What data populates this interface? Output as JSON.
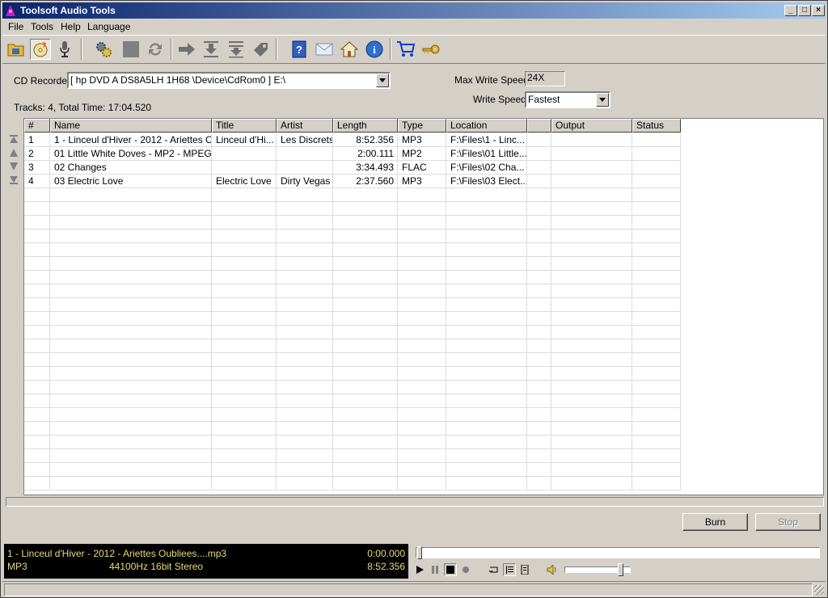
{
  "window": {
    "title": "Toolsoft Audio Tools"
  },
  "menu": {
    "file": "File",
    "tools": "Tools",
    "help": "Help",
    "language": "Language"
  },
  "toolbar": {
    "icons": [
      "open-folder-icon",
      "burn-disc-icon",
      "microphone-icon",
      "settings-gears-icon",
      "stop-square-icon",
      "convert-arrows-icon",
      "forward-arrow-icon",
      "join-down-icon",
      "split-down-icon",
      "tag-icon",
      "help-book-icon",
      "mail-icon",
      "home-icon",
      "info-icon",
      "shopping-cart-icon",
      "key-icon"
    ]
  },
  "recorder": {
    "label": "CD Recorder",
    "device": "[ hp DVD A DS8A5LH 1H68 \\Device\\CdRom0 ] E:\\",
    "max_speed_label": "Max Write Speed",
    "max_speed_value": "24X",
    "write_speed_label": "Write Speed",
    "write_speed_value": "Fastest"
  },
  "summary": "Tracks: 4, Total Time: 17:04.520",
  "grid": {
    "columns": [
      "#",
      "Name",
      "Title",
      "Artist",
      "Length",
      "Type",
      "Location",
      "",
      "Output",
      "Status"
    ],
    "rows": [
      [
        "1",
        "1 - Linceul d'Hiver - 2012 - Ariettes Ou...",
        "Linceul d'Hi...",
        "Les Discrets",
        "8:52.356",
        "MP3",
        "F:\\Files\\1 - Linc...",
        "",
        "",
        ""
      ],
      [
        "2",
        "01 Little White Doves - MP2 - MPEG ...",
        "",
        "",
        "2:00.111",
        "MP2",
        "F:\\Files\\01 Little...",
        "",
        "",
        ""
      ],
      [
        "3",
        "02 Changes",
        "",
        "",
        "3:34.493",
        "FLAC",
        "F:\\Files\\02 Cha...",
        "",
        "",
        ""
      ],
      [
        "4",
        "03 Electric Love",
        "Electric Love",
        "Dirty Vegas",
        "2:37.560",
        "MP3",
        "F:\\Files\\03 Elect...",
        "",
        "",
        ""
      ]
    ]
  },
  "buttons": {
    "burn": "Burn",
    "stop": "Stop"
  },
  "player": {
    "filename": "1 - Linceul d'Hiver - 2012 - Ariettes Oubliees....mp3",
    "format": "MP3",
    "audio_info": "44100Hz 16bit Stereo",
    "position": "0:00.000",
    "duration": "8:52.356",
    "seek_fraction": 0.0,
    "volume_fraction": 0.9
  }
}
